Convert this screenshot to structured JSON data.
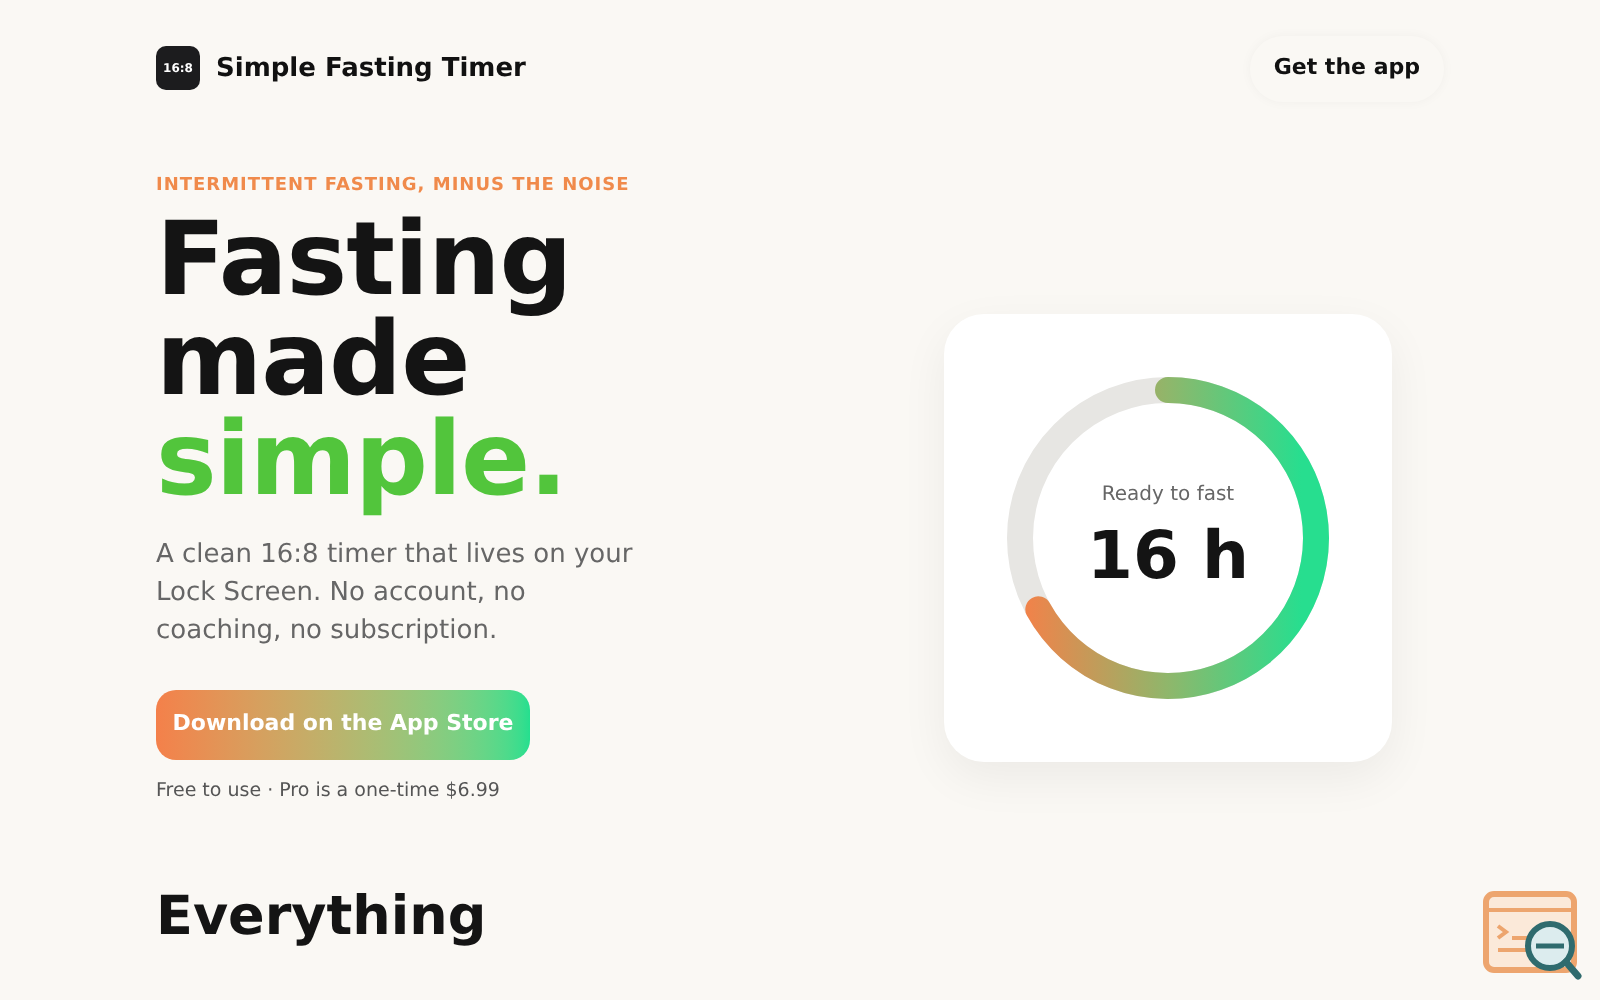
{
  "header": {
    "logo_text": "16:8",
    "brand": "Simple Fasting Timer",
    "cta": "Get the app"
  },
  "hero": {
    "eyebrow": "INTERMITTENT FASTING, MINUS THE NOISE",
    "title_lines": [
      "Fasting",
      "made"
    ],
    "title_accent": "simple.",
    "description": "A clean 16:8 timer that lives on your Lock Screen. No account, no coaching, no subscription.",
    "button": "Download on the App Store",
    "note": "Free to use · Pro is a one-time $6.99"
  },
  "timer": {
    "status": "Ready to fast",
    "duration": "16 h"
  },
  "features": {
    "heading": "Everything"
  }
}
